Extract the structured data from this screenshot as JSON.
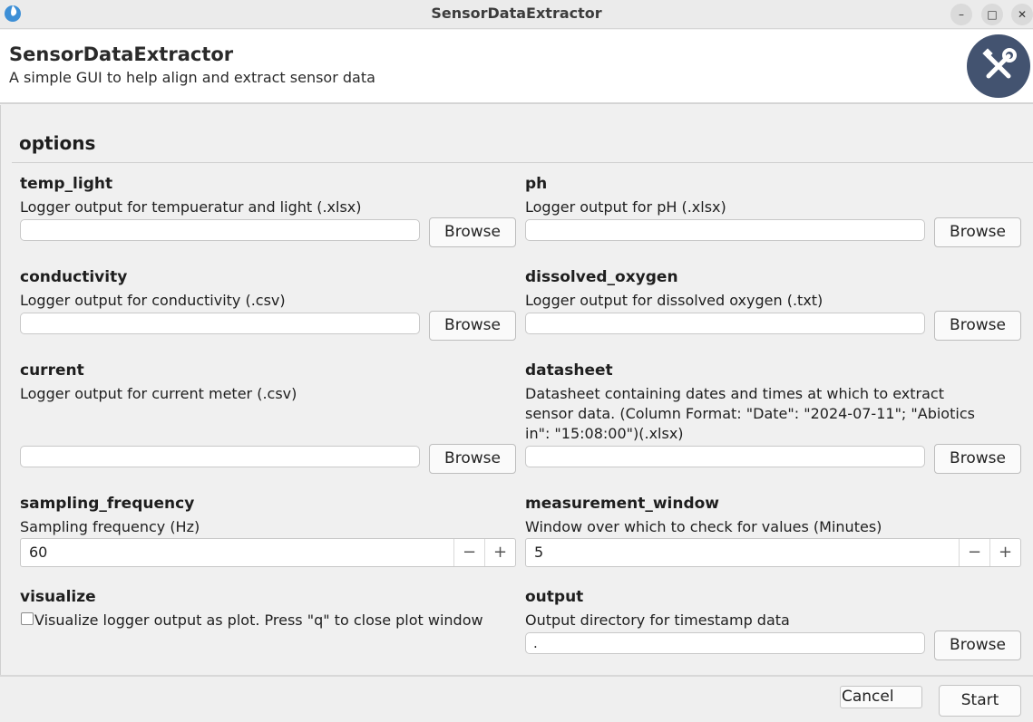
{
  "window": {
    "title": "SensorDataExtractor",
    "minimize_icon": "minimize-icon",
    "maximize_icon": "maximize-icon",
    "close_icon": "close-icon"
  },
  "header": {
    "app_name": "SensorDataExtractor",
    "subtitle": "A simple GUI to help align and extract sensor data",
    "logo_icon": "wrench-screwdriver-icon",
    "logo_color": "#435370"
  },
  "options": {
    "title": "options",
    "temp_light": {
      "label": "temp_light",
      "description": "Logger output for tempueratur and light (.xlsx)",
      "value": "",
      "browse": "Browse"
    },
    "ph": {
      "label": "ph",
      "description": "Logger output for pH (.xlsx)",
      "value": "",
      "browse": "Browse"
    },
    "conductivity": {
      "label": "conductivity",
      "description": "Logger output for conductivity (.csv)",
      "value": "",
      "browse": "Browse"
    },
    "dissolved_oxygen": {
      "label": "dissolved_oxygen",
      "description": "Logger output for dissolved oxygen (.txt)",
      "value": "",
      "browse": "Browse"
    },
    "current": {
      "label": "current",
      "description": "Logger output for current meter (.csv)",
      "value": "",
      "browse": "Browse"
    },
    "datasheet": {
      "label": "datasheet",
      "description": "Datasheet containing dates and times at which to extract sensor data. (Column Format: \"Date\": \"2024-07-11\"; \"Abiotics in\": \"15:08:00\")(.xlsx)",
      "value": "",
      "browse": "Browse"
    },
    "sampling_frequency": {
      "label": "sampling_frequency",
      "description": "Sampling frequency (Hz)",
      "value": "60",
      "minus": "−",
      "plus": "+"
    },
    "measurement_window": {
      "label": "measurement_window",
      "description": "Window over which to check for values (Minutes)",
      "value": "5",
      "minus": "−",
      "plus": "+"
    },
    "visualize": {
      "label": "visualize",
      "description": "Visualize logger output as plot. Press \"q\" to close plot window",
      "checked": false
    },
    "output": {
      "label": "output",
      "description": "Output directory for timestamp data",
      "value": ".",
      "browse": "Browse"
    }
  },
  "footer": {
    "cancel": "Cancel",
    "start": "Start"
  }
}
